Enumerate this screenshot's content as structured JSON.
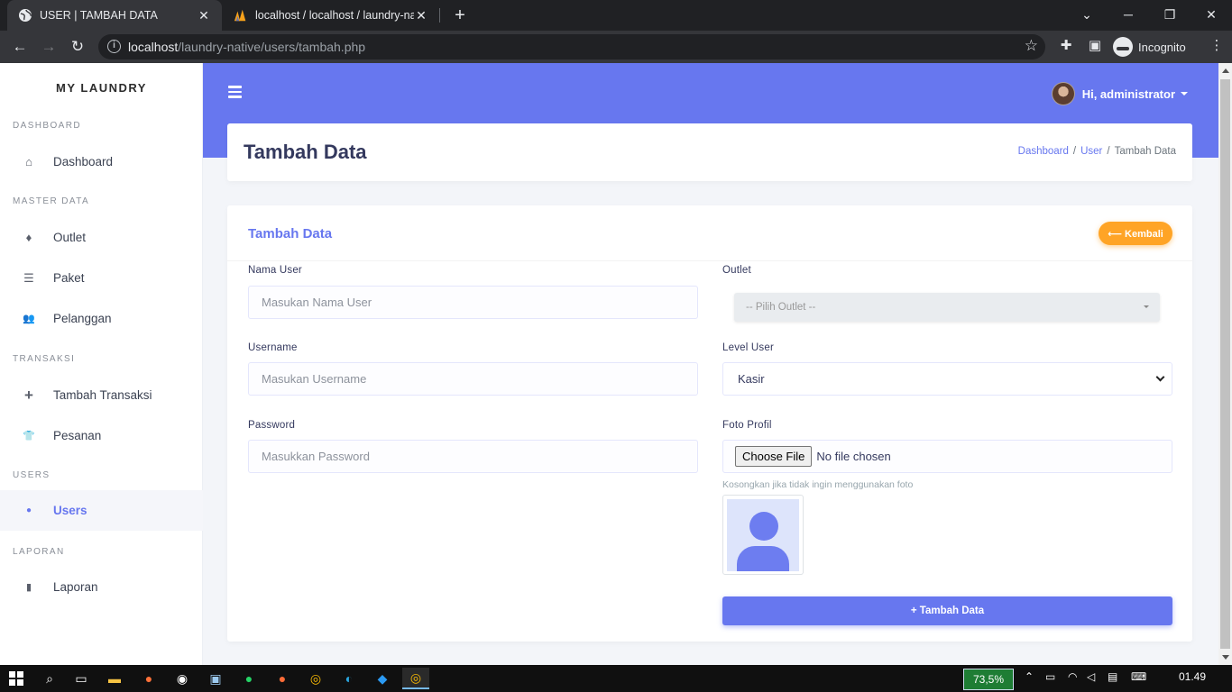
{
  "browser": {
    "tabs": [
      {
        "label": "USER | TAMBAH DATA",
        "active": true
      },
      {
        "label": "localhost / localhost / laundry-na",
        "active": false
      }
    ],
    "url_host": "localhost",
    "url_path": "/laundry-native/users/tambah.php",
    "profile_label": "Incognito"
  },
  "sidebar": {
    "brand": "MY LAUNDRY",
    "sections": [
      {
        "title": "DASHBOARD",
        "items": [
          {
            "label": "Dashboard",
            "icon": "home-icon",
            "glyph": "⌂"
          }
        ]
      },
      {
        "title": "MASTER DATA",
        "items": [
          {
            "label": "Outlet",
            "icon": "fire-icon",
            "glyph": "♦"
          },
          {
            "label": "Paket",
            "icon": "list-icon",
            "glyph": "☰"
          },
          {
            "label": "Pelanggan",
            "icon": "users-icon",
            "glyph": "👥"
          }
        ]
      },
      {
        "title": "TRANSAKSI",
        "items": [
          {
            "label": "Tambah Transaksi",
            "icon": "plus-icon",
            "glyph": "+"
          },
          {
            "label": "Pesanan",
            "icon": "shirt-icon",
            "glyph": "👕"
          }
        ]
      },
      {
        "title": "USERS",
        "items": [
          {
            "label": "Users",
            "icon": "user-icon",
            "glyph": "●",
            "active": true
          }
        ]
      },
      {
        "title": "LAPORAN",
        "items": [
          {
            "label": "Laporan",
            "icon": "file-icon",
            "glyph": "▮"
          }
        ]
      }
    ]
  },
  "topbar": {
    "greeting": "Hi, administrator"
  },
  "page": {
    "title": "Tambah Data",
    "breadcrumb": [
      "Dashboard",
      "User",
      "Tambah Data"
    ]
  },
  "form": {
    "card_title": "Tambah Data",
    "back_label": "⟵ Kembali",
    "nama_user": {
      "label": "Nama User",
      "placeholder": "Masukan Nama User"
    },
    "username": {
      "label": "Username",
      "placeholder": "Masukan Username"
    },
    "password": {
      "label": "Password",
      "placeholder": "Masukkan Password"
    },
    "outlet": {
      "label": "Outlet",
      "value": "-- Pilih Outlet --"
    },
    "level": {
      "label": "Level User",
      "value": "Kasir"
    },
    "foto": {
      "label": "Foto Profil",
      "button": "Choose File",
      "status": "No file chosen",
      "hint": "Kosongkan jika tidak ingin menggunakan foto"
    },
    "submit_label": "+ Tambah Data"
  },
  "taskbar": {
    "battery": "73,5%",
    "clock": "01.49"
  }
}
